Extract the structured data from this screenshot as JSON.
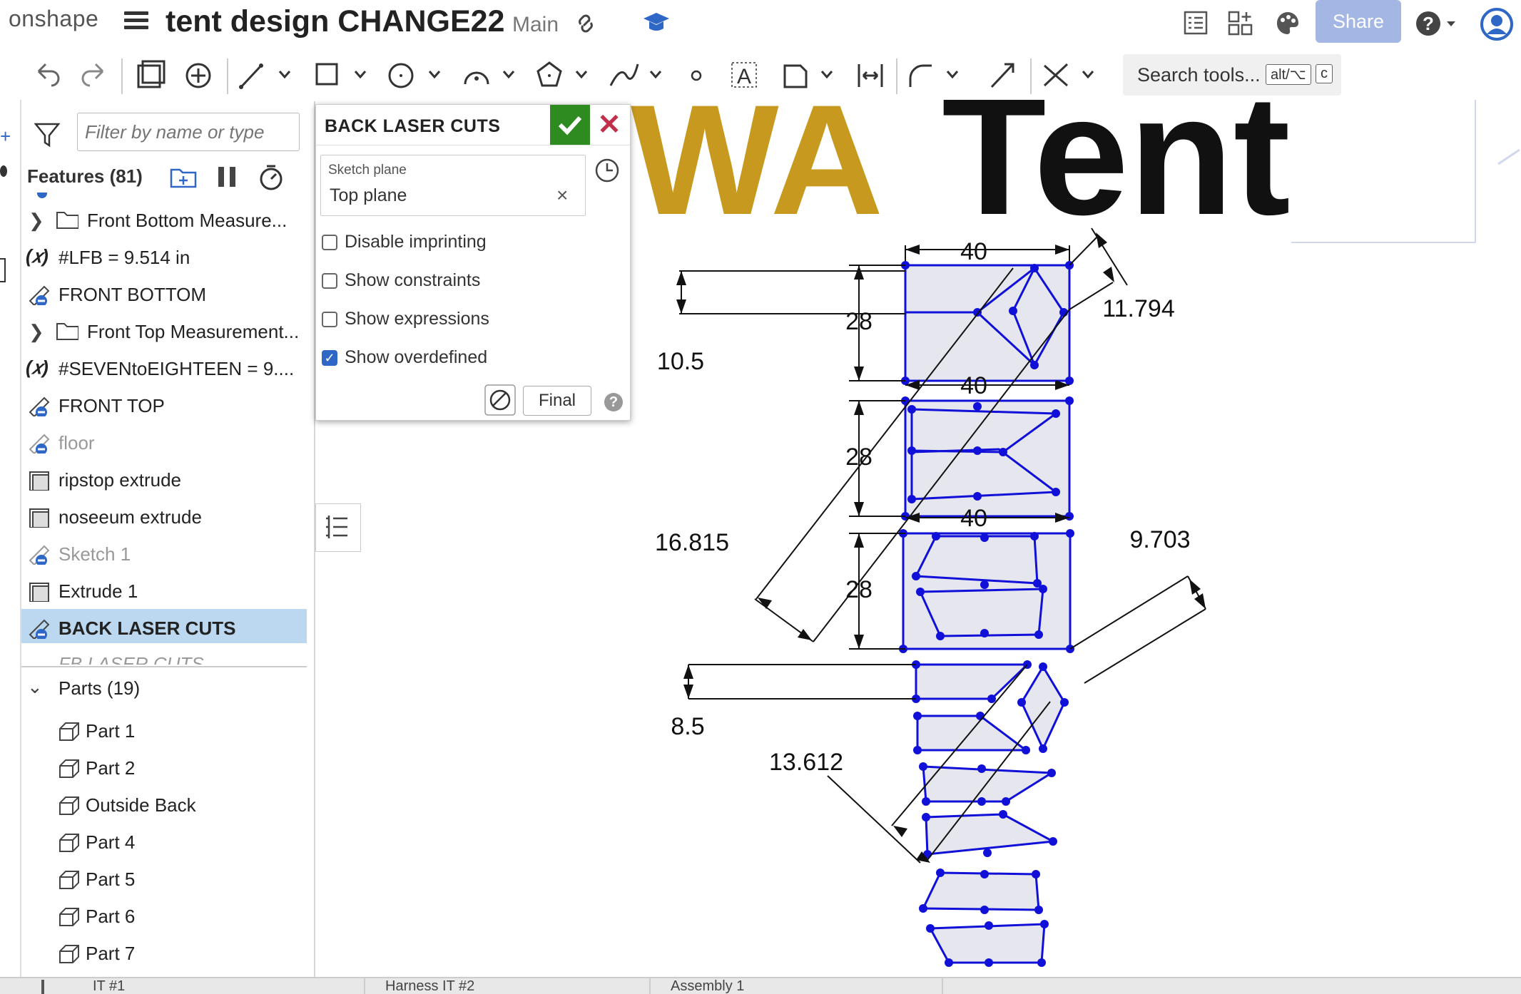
{
  "app": {
    "logo": "onshape",
    "title": "tent design CHANGE22",
    "branch": "Main",
    "share_label": "Share"
  },
  "toolbar": {
    "search_placeholder": "Search tools...",
    "shortcut_key1": "alt/⌥",
    "shortcut_key2": "c"
  },
  "panel": {
    "filter_placeholder": "Filter by name or type",
    "features_header": "Features (81)",
    "features": [
      {
        "label": "Front Bottom Measure...",
        "kind": "folder"
      },
      {
        "label": "#LFB = 9.514 in",
        "kind": "variable"
      },
      {
        "label": "FRONT BOTTOM",
        "kind": "sketch"
      },
      {
        "label": "Front Top Measurement...",
        "kind": "folder"
      },
      {
        "label": "#SEVENtoEIGHTEEN = 9....",
        "kind": "variable"
      },
      {
        "label": "FRONT TOP",
        "kind": "sketch"
      },
      {
        "label": "floor",
        "kind": "sketch-dim"
      },
      {
        "label": "ripstop extrude",
        "kind": "extrude"
      },
      {
        "label": "noseeum extrude",
        "kind": "extrude"
      },
      {
        "label": "Sketch 1",
        "kind": "sketch-dim"
      },
      {
        "label": "Extrude 1",
        "kind": "extrude"
      },
      {
        "label": "BACK LASER CUTS",
        "kind": "sketch-selected"
      },
      {
        "label": "FB LASER CUTS",
        "kind": "sketch-dim"
      }
    ],
    "parts_header": "Parts (19)",
    "parts": [
      "Part 1",
      "Part 2",
      "Outside Back",
      "Part 4",
      "Part 5",
      "Part 6",
      "Part 7"
    ]
  },
  "dialog": {
    "title": "BACK LASER CUTS",
    "sketch_plane_label": "Sketch plane",
    "sketch_plane_value": "Top plane",
    "options": [
      {
        "label": "Disable imprinting",
        "checked": false
      },
      {
        "label": "Show constraints",
        "checked": false
      },
      {
        "label": "Show expressions",
        "checked": false
      },
      {
        "label": "Show overdefined",
        "checked": true
      }
    ],
    "final_label": "Final",
    "help_label": "?"
  },
  "canvas": {
    "banner_gold": "WA",
    "banner_black": "Tent",
    "dimensions": [
      "40",
      "40",
      "40",
      "28",
      "28",
      "28",
      "11.794",
      "10.5",
      "16.815",
      "9.703",
      "8.5",
      "13.612"
    ],
    "sketch_color": "#1010d8",
    "fill_color": "#e6e6ee",
    "gold": "#c79a1f"
  },
  "bottom_tabs": [
    "IT #1",
    "Harness IT #2",
    "Assembly 1"
  ]
}
